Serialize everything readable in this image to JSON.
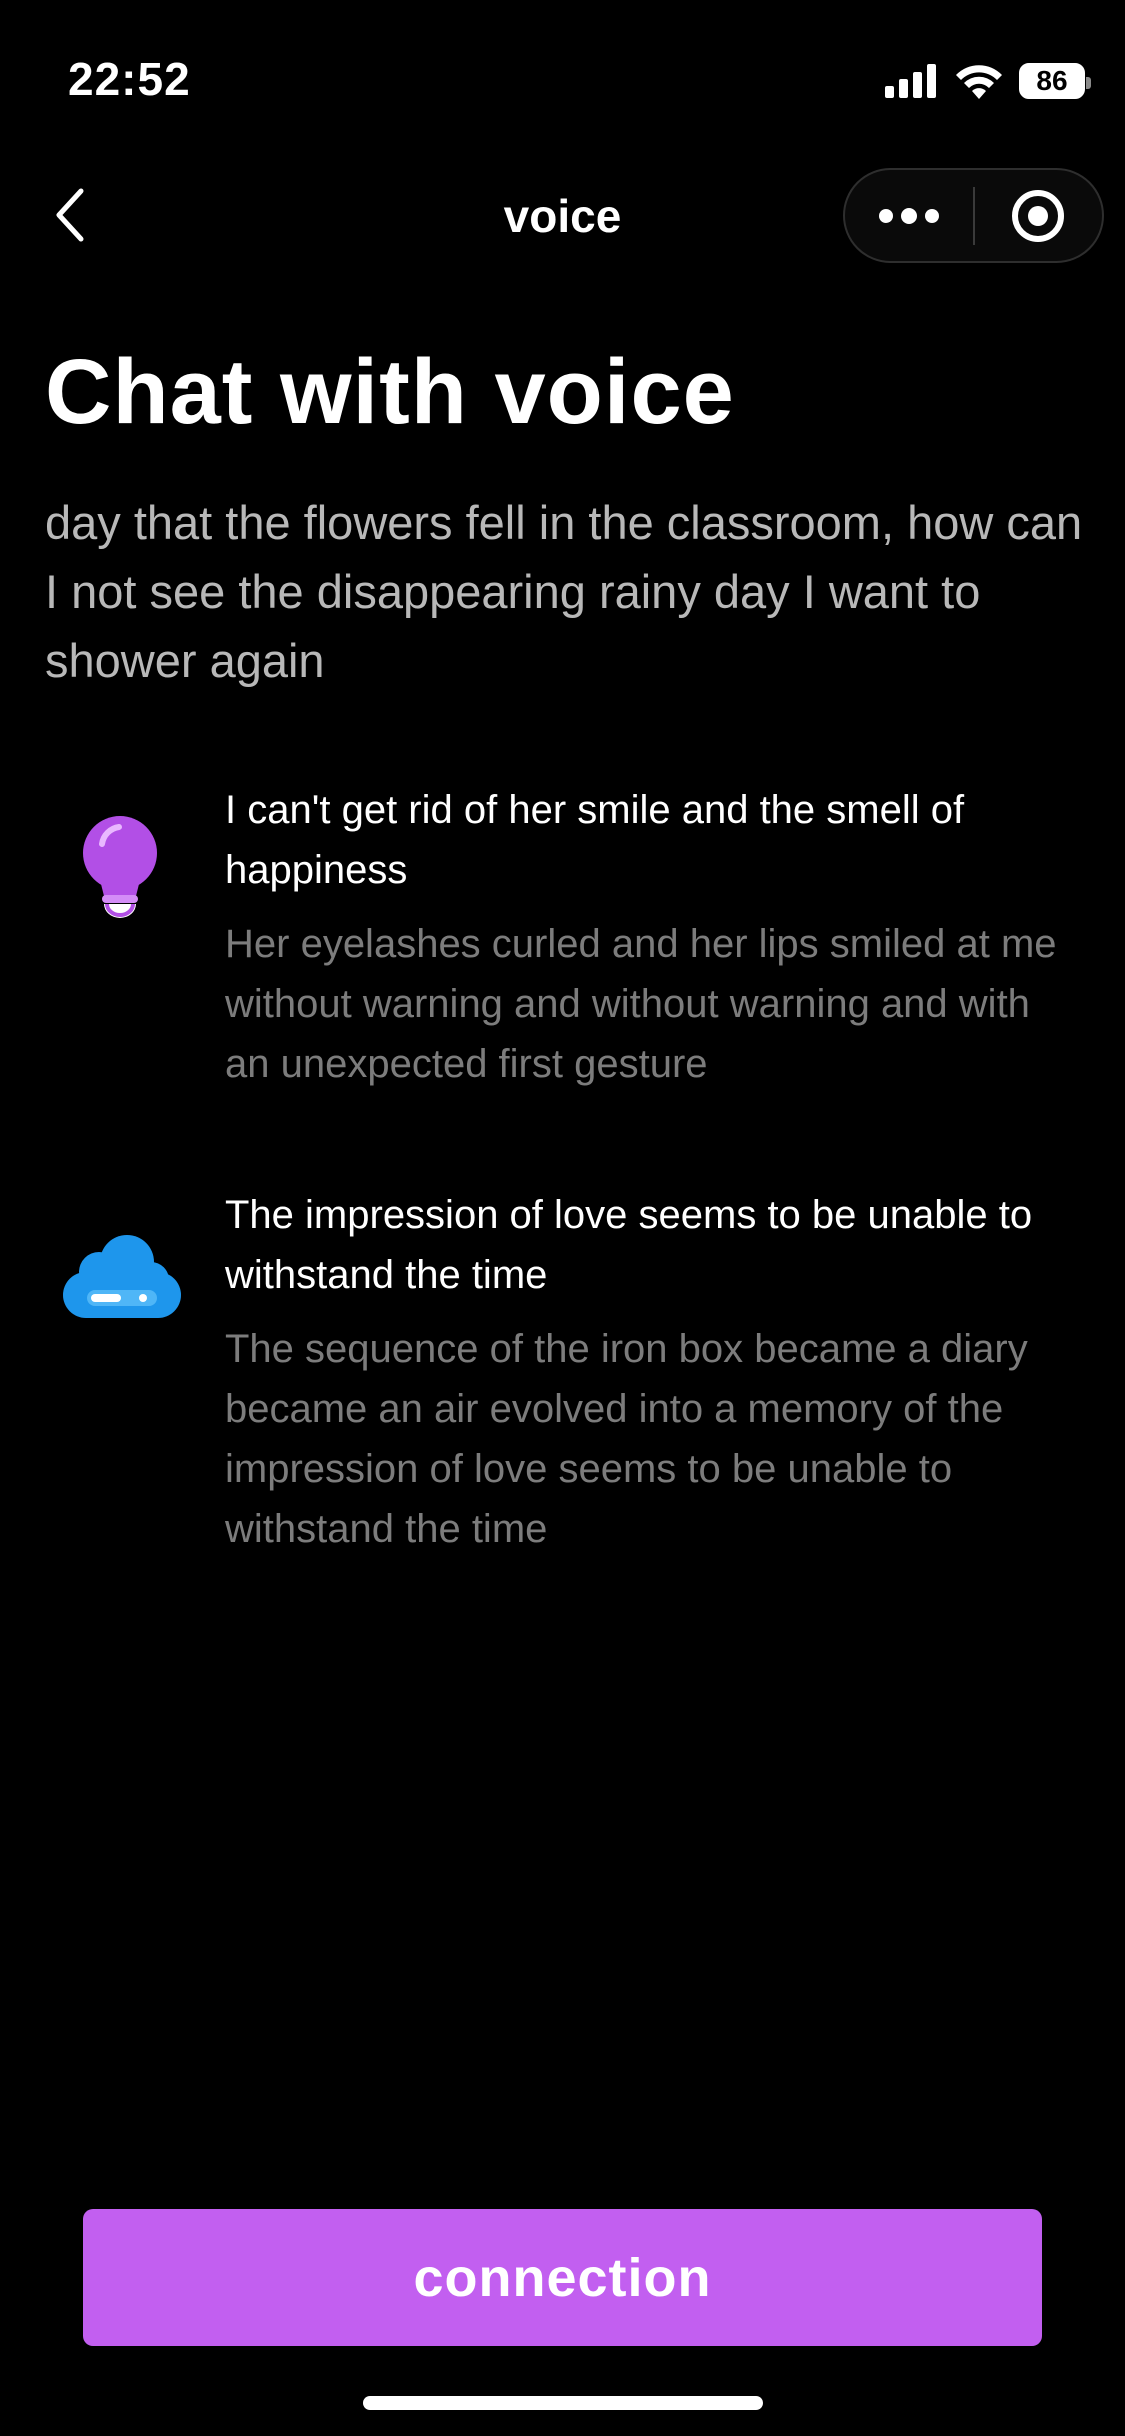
{
  "status_bar": {
    "time": "22:52",
    "battery": "86",
    "icons": [
      "signal-icon",
      "wifi-icon",
      "battery-icon"
    ]
  },
  "nav": {
    "title": "voice",
    "icons": [
      "back-chevron-icon",
      "more-dots-icon",
      "close-target-icon"
    ]
  },
  "page": {
    "title": "Chat with voice",
    "intro": "day that the flowers fell in the classroom, how can I not see the disappearing rainy day I want to shower again"
  },
  "features": [
    {
      "icon": "lightbulb-icon",
      "title": "I can't get rid of her smile and the smell of happiness",
      "description": "Her eyelashes curled and her lips smiled at me without warning and without warning and with an unexpected first gesture"
    },
    {
      "icon": "cloud-icon",
      "title": "The impression of love seems to be unable to withstand the time",
      "description": "The sequence of the iron box became a diary became an air evolved into a memory of the impression of love seems to be unable to withstand the time"
    }
  ],
  "action": {
    "button_label": "connection"
  },
  "colors": {
    "background": "#000000",
    "accent": "#c25ff0",
    "bulb": "#b24fe6",
    "cloud": "#1e96ec",
    "muted_text": "#7c7c7c"
  }
}
